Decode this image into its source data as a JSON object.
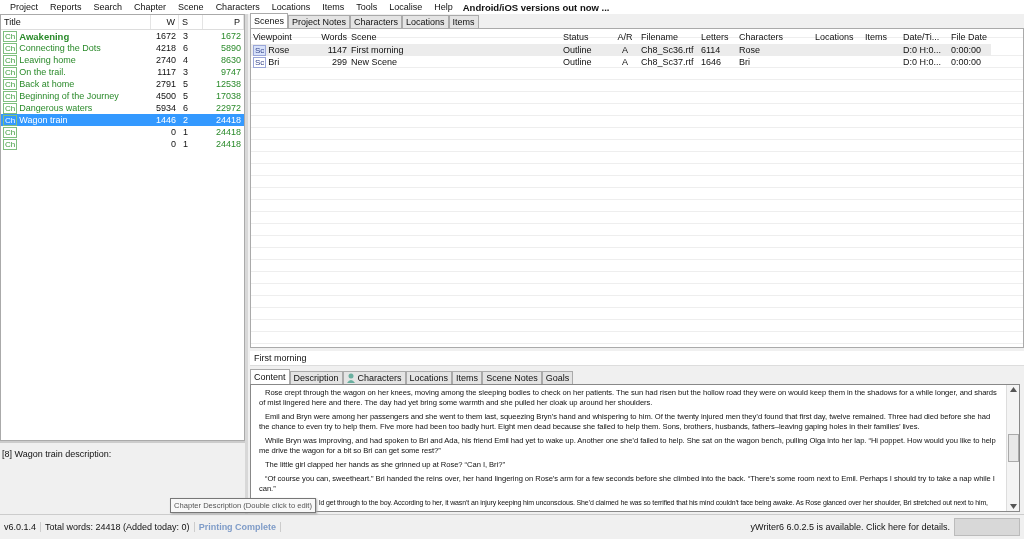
{
  "menu": [
    "Project",
    "Reports",
    "Search",
    "Chapter",
    "Scene",
    "Characters",
    "Locations",
    "Items",
    "Tools",
    "Localise",
    "Help"
  ],
  "banner": "Android/iOS versions out now ...",
  "chapters": {
    "columns": [
      "Title",
      "W",
      "S",
      "P"
    ],
    "rows": [
      {
        "tag": "Ch",
        "title": "Awakening",
        "w": "1672",
        "s": "3",
        "p": "1672",
        "bold": true,
        "selected": false
      },
      {
        "tag": "Ch",
        "title": "Connecting the Dots",
        "w": "4218",
        "s": "6",
        "p": "5890",
        "bold": false,
        "selected": false
      },
      {
        "tag": "Ch",
        "title": "Leaving home",
        "w": "2740",
        "s": "4",
        "p": "8630",
        "bold": false,
        "selected": false
      },
      {
        "tag": "Ch",
        "title": "On the trail.",
        "w": "1117",
        "s": "3",
        "p": "9747",
        "bold": false,
        "selected": false
      },
      {
        "tag": "Ch",
        "title": "Back at home",
        "w": "2791",
        "s": "5",
        "p": "12538",
        "bold": false,
        "selected": false
      },
      {
        "tag": "Ch",
        "title": "Beginning of the Journey",
        "w": "4500",
        "s": "5",
        "p": "17038",
        "bold": false,
        "selected": false
      },
      {
        "tag": "Ch",
        "title": "Dangerous waters",
        "w": "5934",
        "s": "6",
        "p": "22972",
        "bold": false,
        "selected": false
      },
      {
        "tag": "Ch",
        "title": "Wagon train",
        "w": "1446",
        "s": "2",
        "p": "24418",
        "bold": false,
        "selected": true
      },
      {
        "tag": "Ch",
        "w": "0",
        "s": "1",
        "p": "24418",
        "selected": false
      },
      {
        "tag": "Ch",
        "w": "0",
        "s": "1",
        "p": "24418",
        "selected": false
      }
    ]
  },
  "chapter_description": "[8] Wagon train description:",
  "top_tabs": [
    {
      "label": "Scenes",
      "selected": true
    },
    {
      "label": "Project Notes",
      "selected": false
    },
    {
      "label": "Characters",
      "selected": false
    },
    {
      "label": "Locations",
      "selected": false
    },
    {
      "label": "Items",
      "selected": false
    }
  ],
  "scenes": {
    "columns": [
      "Viewpoint",
      "Words",
      "Scene",
      "Status",
      "A/R",
      "Filename",
      "Letters",
      "Characters",
      "Locations",
      "Items",
      "Date/Ti...",
      "File Date"
    ],
    "rows": [
      {
        "tag": "Sc",
        "cells": [
          "Rose",
          "1147",
          "First morning",
          "Outline",
          "A",
          "Ch8_Sc36.rtf",
          "6114",
          "Rose",
          "",
          "",
          "D:0 H:0...",
          "0:00:00"
        ],
        "selected": true
      },
      {
        "tag": "Sc",
        "cells": [
          "Bri",
          "299",
          "New Scene",
          "Outline",
          "A",
          "Ch8_Sc37.rtf",
          "1646",
          "Bri",
          "",
          "",
          "D:0 H:0...",
          "0:00:00"
        ],
        "selected": false
      }
    ]
  },
  "scene_title": "First morning",
  "editor_tabs": [
    {
      "label": "Content",
      "selected": true,
      "kind": "plain"
    },
    {
      "label": "Description",
      "selected": false,
      "kind": "plain"
    },
    {
      "label": "Characters",
      "selected": false,
      "kind": "person"
    },
    {
      "label": "Locations",
      "selected": false,
      "kind": "plain"
    },
    {
      "label": "Items",
      "selected": false,
      "kind": "plain"
    },
    {
      "label": "Scene Notes",
      "selected": false,
      "kind": "plain"
    },
    {
      "label": "Goals",
      "selected": false,
      "kind": "plain"
    }
  ],
  "content": [
    "Rose crept through the wagon on her knees, moving among the sleeping bodies to check on her patients. The sun had risen but the hollow road they were on would keep them in the shadows for a while longer, and shards of mist lingered here and there. The day had yet bring some warmth and she pulled her cloak up around her shoulders.",
    "Emil and Bryn were among her passengers and she went to them last, squeezing Bryn’s hand and whispering to him. Of the twenty injured men they’d found that first day, twelve remained. Three had died before she had the chance to even try to help them. Five more had been too badly hurt. Eight men dead because she failed to help them. Sons, brothers, husbands, fathers–leaving gaping holes in their families’ lives.",
    "While Bryn was improving, and had spoken to Bri and Ada, his friend Emil had yet to wake up. Another one she’d failed to help. She sat on the wagon bench, pulling Olga into her lap. “Hi poppet. How would you like to help me drive the wagon for a bit so Bri can get some rest?”",
    "The little girl clapped her hands as she grinned up at Rose? “Can I, Bri?”",
    "“Of course you can, sweetheart.” Bri handed the reins over, her hand lingering on Rose’s arm for a few seconds before she climbed into the back. “There’s some room next to Emil. Perhaps I should try to take a nap while I can.”"
  ],
  "content_partial": "ld get through to the boy. According to her, it wasn’t an injury keeping him unconscious. She’d claimed he was so terrified that his mind couldn’t face being awake. As Rose glanced over her shoulder, Bri stretched out next to him,",
  "tooltip": "Chapter Description (Double click to edit)",
  "status": {
    "version": "v6.0.1.4",
    "words": "Total words: 24418 (Added today: 0)",
    "message": "Printing Complete",
    "update": "yWriter6 6.0.2.5 is available. Click here for details."
  }
}
